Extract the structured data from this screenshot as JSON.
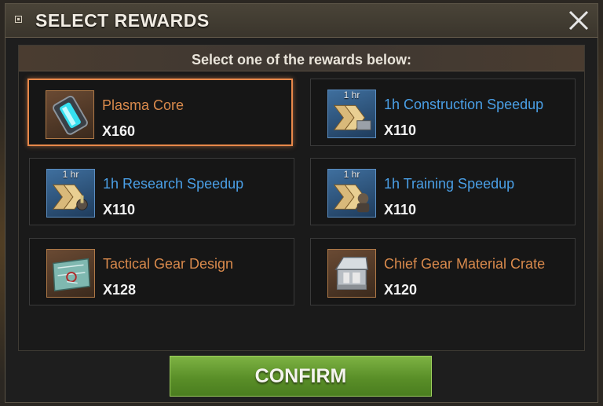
{
  "dialog": {
    "title": "SELECT REWARDS",
    "instruction": "Select one of the rewards below:",
    "confirm_label": "CONFIRM"
  },
  "rewards": [
    {
      "name": "Plasma Core",
      "quantity": "X160",
      "badge": "",
      "name_color": "#d98a4c",
      "icon": "plasma-core-icon",
      "selected": true
    },
    {
      "name": "1h Construction Speedup",
      "quantity": "X110",
      "badge": "1 hr",
      "name_color": "#4a9fe6",
      "icon": "construction-speedup-icon",
      "selected": false
    },
    {
      "name": "1h Research Speedup",
      "quantity": "X110",
      "badge": "1 hr",
      "name_color": "#4a9fe6",
      "icon": "research-speedup-icon",
      "selected": false
    },
    {
      "name": "1h Training Speedup",
      "quantity": "X110",
      "badge": "1 hr",
      "name_color": "#4a9fe6",
      "icon": "training-speedup-icon",
      "selected": false
    },
    {
      "name": "Tactical Gear Design",
      "quantity": "X128",
      "badge": "",
      "name_color": "#d98a4c",
      "icon": "gear-design-map-icon",
      "selected": false
    },
    {
      "name": "Chief Gear Material Crate",
      "quantity": "X120",
      "badge": "",
      "name_color": "#d98a4c",
      "icon": "material-crate-icon",
      "selected": false
    }
  ]
}
